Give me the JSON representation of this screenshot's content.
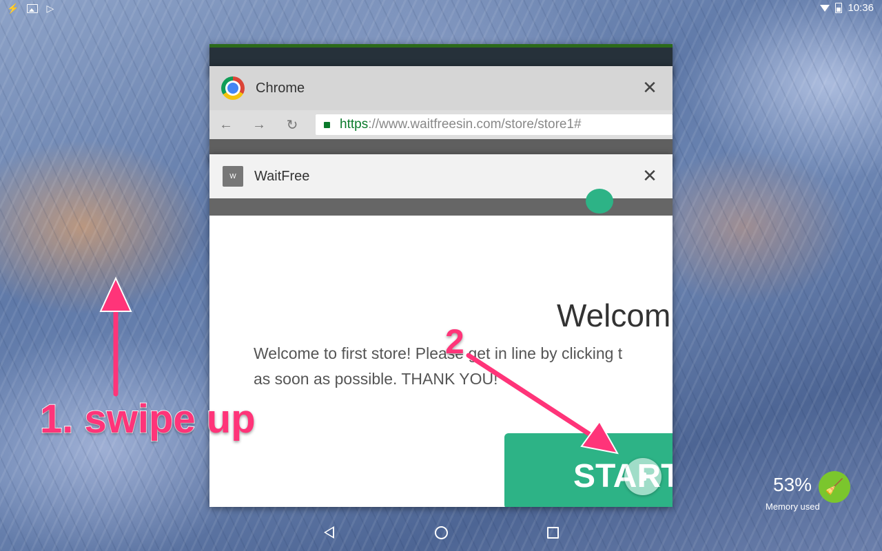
{
  "status_bar": {
    "time": "10:36",
    "icons_left": [
      "bolt-icon",
      "image-icon",
      "play-store-icon"
    ],
    "icons_right": [
      "wifi-icon",
      "battery-icon"
    ]
  },
  "recents": {
    "cards": [
      {
        "app": "Chrome",
        "icon": "chrome-icon",
        "url_scheme": "https",
        "url_rest": "://www.waitfreesin.com/store/store1#"
      },
      {
        "app": "WaitFree",
        "icon_letter": "W",
        "heading": "Welcom",
        "body_line1": "Welcome to first store! Please get in line by clicking t",
        "body_line2": "as soon as possible. THANK YOU!",
        "button_label": "START"
      }
    ]
  },
  "annotations": {
    "step1": "1. swipe up",
    "step2": "2",
    "color": "#ff3479"
  },
  "memory_widget": {
    "percent": "53%",
    "label": "Memory used",
    "accent": "#7bc62d"
  },
  "nav_bar": {
    "buttons": [
      "back-icon",
      "home-icon",
      "recent-apps-icon"
    ]
  },
  "colors": {
    "waitfree_green": "#2db386"
  }
}
